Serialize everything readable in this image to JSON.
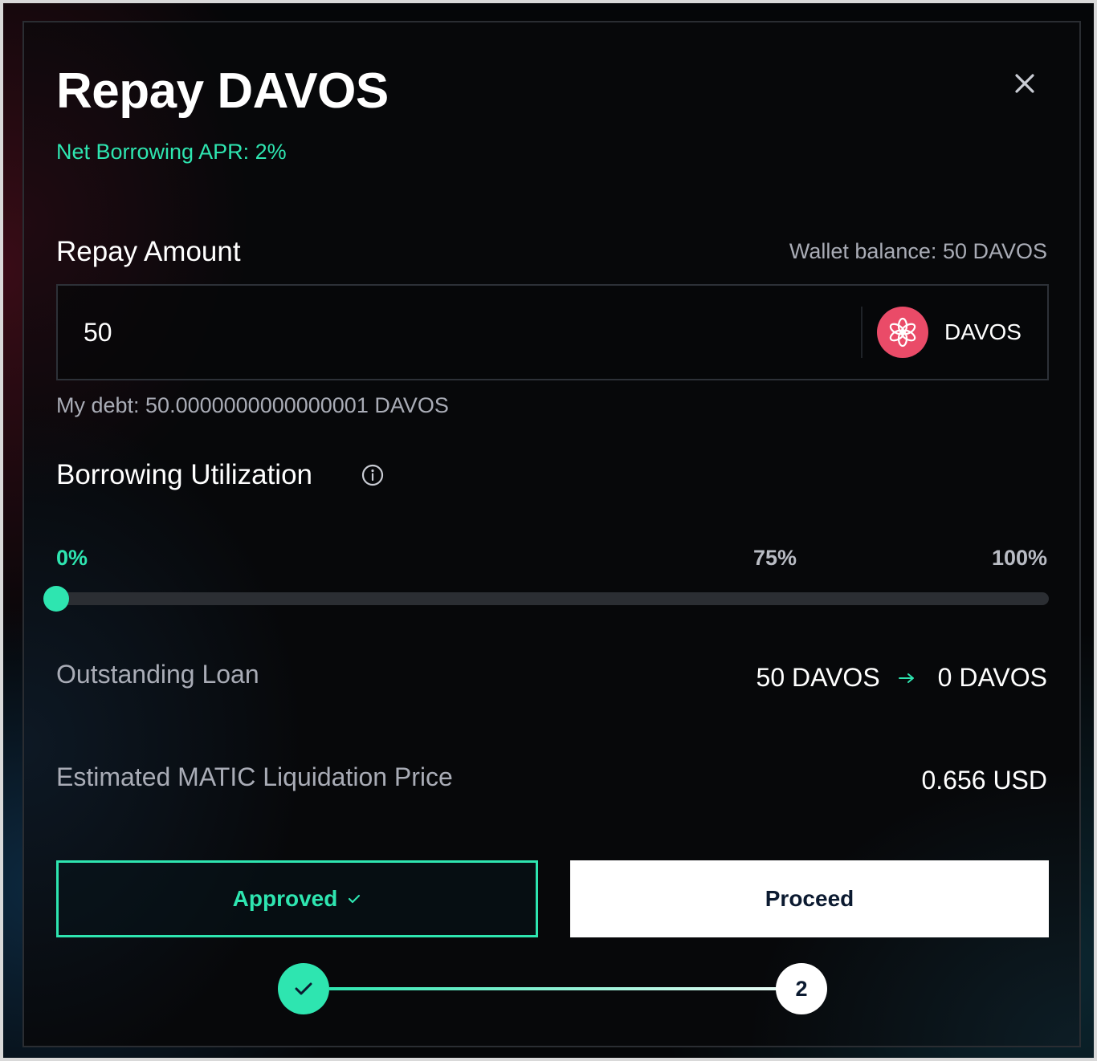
{
  "modal": {
    "title": "Repay DAVOS",
    "apr_text": "Net Borrowing APR: 2%"
  },
  "repay": {
    "section_title": "Repay Amount",
    "wallet_balance": "Wallet balance: 50 DAVOS",
    "amount_value": "50",
    "token_name": "DAVOS",
    "debt_text": "My debt: 50.0000000000000001 DAVOS"
  },
  "utilization": {
    "section_title": "Borrowing Utilization",
    "ticks": [
      "0%",
      "75%",
      "100%"
    ],
    "value_percent": 0
  },
  "details": {
    "loan_label": "Outstanding Loan",
    "loan_from": "50 DAVOS",
    "loan_to": "0 DAVOS",
    "liquidation_label": "Estimated MATIC Liquidation Price",
    "liquidation_value": "0.656 USD"
  },
  "actions": {
    "approved_label": "Approved",
    "proceed_label": "Proceed"
  },
  "stepper": {
    "step2_label": "2"
  },
  "colors": {
    "accent": "#2ee5b0",
    "token_logo": "#ea4b68",
    "background": "#07080a"
  },
  "icons": {
    "close": "close-icon",
    "info": "info-icon",
    "token": "davos-logo-icon",
    "arrow": "arrow-right-icon",
    "check": "check-icon"
  }
}
